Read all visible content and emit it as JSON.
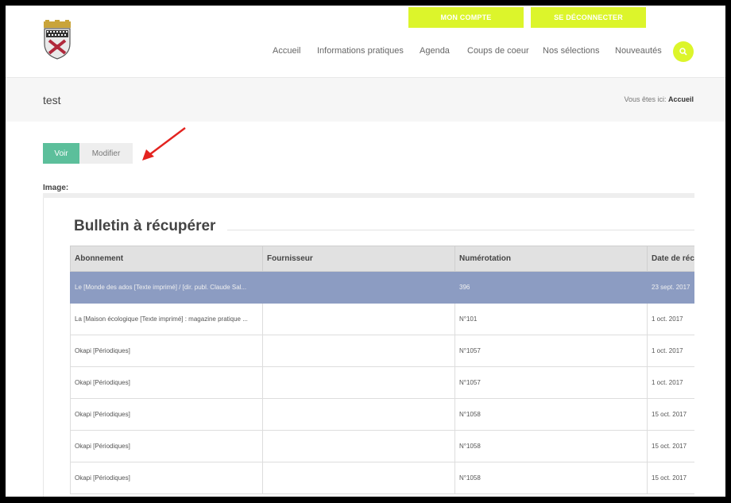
{
  "header": {
    "my_account_label": "MON COMPTE",
    "logout_label": "SE DÉCONNECTER",
    "nav": [
      "Accueil",
      "Informations pratiques",
      "Agenda",
      "Coups de coeur",
      "Nos sélections",
      "Nouveautés"
    ]
  },
  "page": {
    "title": "test",
    "breadcrumb_prefix": "Vous êtes ici:",
    "breadcrumb_current": "Accueil"
  },
  "tabs": {
    "view_label": "Voir",
    "edit_label": "Modifier"
  },
  "content": {
    "image_label": "Image:",
    "bulletin_title": "Bulletin à récupérer",
    "columns": [
      "Abonnement",
      "Fournisseur",
      "Numérotation",
      "Date de réc"
    ],
    "rows": [
      {
        "abonnement": "Le [Monde des ados [Texte imprimé] / [dir. publ. Claude Sal...",
        "fournisseur": "",
        "numerotation": "396",
        "date": "23 sept. 2017",
        "selected": true
      },
      {
        "abonnement": "La [Maison écologique [Texte imprimé] : magazine pratique ...",
        "fournisseur": "",
        "numerotation": "N°101",
        "date": "1 oct. 2017",
        "selected": false
      },
      {
        "abonnement": "Okapi [Périodiques]",
        "fournisseur": "",
        "numerotation": "N°1057",
        "date": "1 oct. 2017",
        "selected": false
      },
      {
        "abonnement": "Okapi [Périodiques]",
        "fournisseur": "",
        "numerotation": "N°1057",
        "date": "1 oct. 2017",
        "selected": false
      },
      {
        "abonnement": "Okapi [Périodiques]",
        "fournisseur": "",
        "numerotation": "N°1058",
        "date": "15 oct. 2017",
        "selected": false
      },
      {
        "abonnement": "Okapi [Périodiques]",
        "fournisseur": "",
        "numerotation": "N°1058",
        "date": "15 oct. 2017",
        "selected": false
      },
      {
        "abonnement": "Okapi [Périodiques]",
        "fournisseur": "",
        "numerotation": "N°1058",
        "date": "15 oct. 2017",
        "selected": false
      }
    ]
  },
  "icons": {
    "search": "search-icon",
    "logo": "coat-of-arms-logo",
    "arrow": "red-arrow-annotation"
  },
  "colors": {
    "accent": "#dcf52b",
    "tab_active": "#5cbf9b",
    "row_selected": "#8c9cc2",
    "arrow": "#e3231f"
  }
}
